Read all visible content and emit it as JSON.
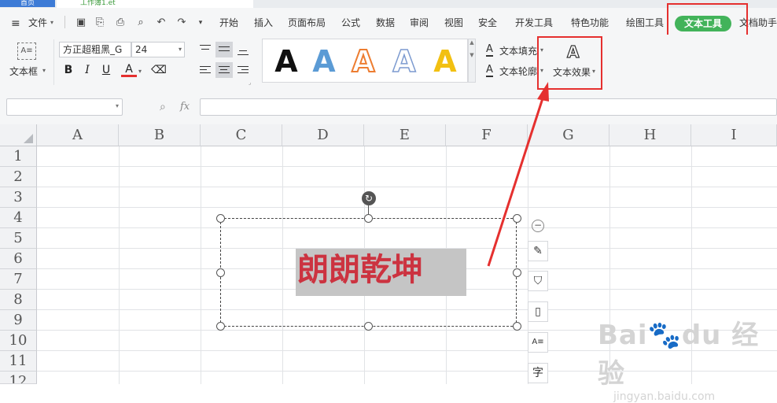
{
  "tabstrip": {
    "home_tab": "首页",
    "doc_tab": "工作簿1.et"
  },
  "menu": {
    "file": "文件",
    "tabs": [
      "开始",
      "插入",
      "页面布局",
      "公式",
      "数据",
      "审阅",
      "视图",
      "安全",
      "开发工具",
      "特色功能",
      "绘图工具",
      "文本工具",
      "文档助手"
    ],
    "active_tab": "文本工具"
  },
  "ribbon": {
    "textbox_label": "文本框",
    "font_name": "方正超粗黑_G",
    "font_size": "24",
    "format_buttons": [
      "B",
      "I",
      "U",
      "A"
    ],
    "text_fill": "文本填充",
    "text_outline": "文本轮廓",
    "text_effect": "文本效果",
    "styles": [
      "A",
      "A",
      "A",
      "A",
      "A"
    ],
    "style_colors": [
      "#111111",
      "#5b9bd5",
      "#ed7d31",
      "#9bb3dc",
      "#f2c011"
    ]
  },
  "formula": {
    "fx_label": "fx"
  },
  "grid": {
    "columns": [
      "A",
      "B",
      "C",
      "D",
      "E",
      "F",
      "G",
      "H",
      "I"
    ],
    "rows": [
      "1",
      "2",
      "3",
      "4",
      "5",
      "6",
      "7",
      "8",
      "9",
      "10",
      "11",
      "12"
    ]
  },
  "textbox": {
    "content": "朗朗乾坤"
  },
  "accent": {
    "green": "#42b35a",
    "red": "#e5302f"
  }
}
